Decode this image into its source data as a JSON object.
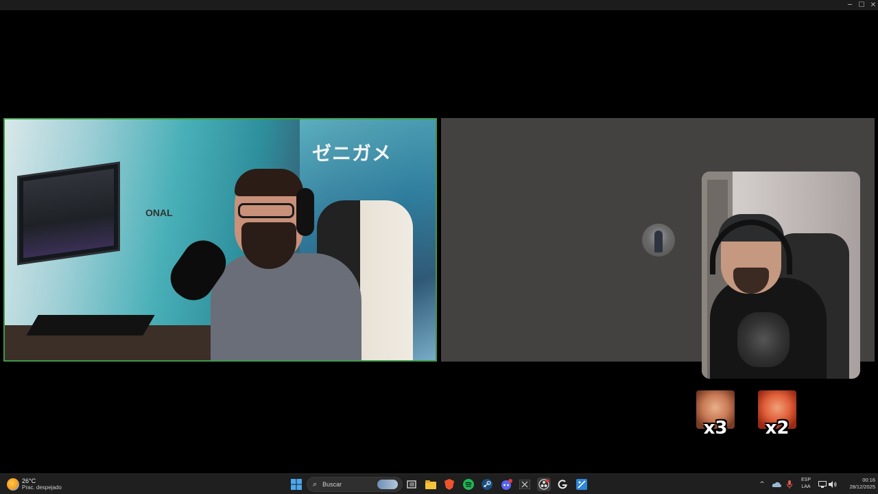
{
  "window": {
    "controls": [
      "minimize-icon",
      "maximize-icon",
      "close-icon"
    ],
    "minimize_glyph": "─",
    "maximize_glyph": "☐",
    "close_glyph": "✕"
  },
  "call": {
    "left_tile": {
      "active_speaker_border": "#3f9a4c",
      "mural_text": "ゼニガメ",
      "mural_fragment": "ONAL"
    },
    "right_tile": {
      "background": "#444240"
    },
    "reactions": [
      {
        "name": "laughing-face-reaction",
        "count": "x3"
      },
      {
        "name": "crying-face-reaction",
        "count": "x2"
      }
    ]
  },
  "taskbar": {
    "weather": {
      "temp": "26°C",
      "description": "Prac. despejado",
      "icon": "partly-sunny-icon"
    },
    "start_icon": "windows-start-icon",
    "search": {
      "icon": "search-icon",
      "placeholder": "Buscar"
    },
    "apps": [
      "task-view-icon",
      "file-explorer-icon",
      "brave-browser-icon",
      "spotify-icon",
      "steam-icon",
      "discord-icon",
      "excel-icon",
      "obs-icon",
      "logitech-g-icon",
      "snipping-tool-icon"
    ],
    "tray": {
      "chevron": "^",
      "language_top": "ESP",
      "language_bottom": "LAA",
      "time": "00:16",
      "date": "28/12/2025"
    }
  }
}
